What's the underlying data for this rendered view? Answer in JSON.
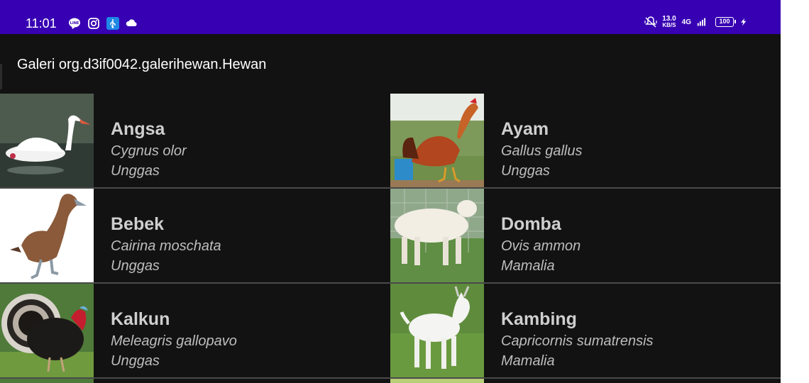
{
  "status_bar": {
    "time": "11:01",
    "net_speed": "13.0",
    "net_unit": "KB/S",
    "net_type": "4G",
    "battery": "100",
    "icons_left": [
      "line-icon",
      "instagram-icon",
      "usb-icon",
      "cloud-icon"
    ],
    "icons_right": [
      "mute-bell-icon",
      "signal-icon",
      "charging-icon"
    ]
  },
  "app_bar": {
    "title": "Galeri org.d3if0042.galerihewan.Hewan"
  },
  "animals": [
    {
      "name": "Angsa",
      "latin": "Cygnus olor",
      "class": "Unggas",
      "image": "swan"
    },
    {
      "name": "Ayam",
      "latin": "Gallus gallus",
      "class": "Unggas",
      "image": "rooster"
    },
    {
      "name": "Bebek",
      "latin": "Cairina moschata",
      "class": "Unggas",
      "image": "duck"
    },
    {
      "name": "Domba",
      "latin": "Ovis ammon",
      "class": "Mamalia",
      "image": "sheep"
    },
    {
      "name": "Kalkun",
      "latin": "Meleagris gallopavo",
      "class": "Unggas",
      "image": "turkey"
    },
    {
      "name": "Kambing",
      "latin": "Capricornis sumatrensis",
      "class": "Mamalia",
      "image": "goat"
    }
  ],
  "colors": {
    "status_bar": "#3700b3",
    "background": "#121212",
    "title_text": "#ffffff",
    "item_text": "#cfcfcf",
    "divider": "#4a4a4a"
  }
}
